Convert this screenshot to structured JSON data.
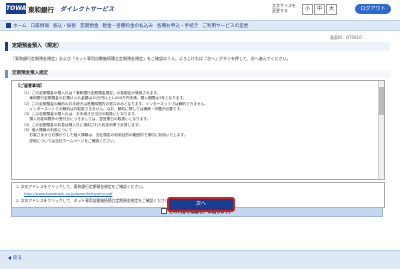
{
  "header": {
    "logo_mark": "TOWA",
    "bank_name": "東和銀行",
    "service_name": "ダイレクトサービス",
    "font_size_label": "文字サイズを\n変更する",
    "font_sizes": [
      "小",
      "中",
      "大"
    ],
    "logout_label": "ログアウト"
  },
  "nav": {
    "items": [
      "ホーム",
      "口座情報",
      "振込・振替",
      "定期預金",
      "税金・各種料金の払込み",
      "各種お申込・手続き",
      "ご利用サービスの変更"
    ]
  },
  "screen_id": "画面ID：BT0010",
  "page": {
    "title": "定期預金預入（規定）",
    "intro": "「東和銀行定期預金規定」および「ネット専用自動継続積立定期預金規定」をご確認のうえ、よろしければ「次へ」ボタンを押して、次へ進んでください。",
    "section_title": "定期預金預入規定"
  },
  "terms": {
    "heading": "【ご留意事項】",
    "lines": [
      "（1）この定期預金の預入れは「東和銀行定期預金規定」の各規定が適用されます。",
      "　　東和銀行定期預金のお預け入れ金額は10万円以上1,000万円未満、預入期間は3年となります。",
      "（2）この定期預金の解約のお手続きは営業時間内の窓口のみとなります。インターネットでは解約できません。",
      "　　インターネットでの解約はお取扱できません。なお、解約に際しては通帳・印鑑が必要です。",
      "（3）この定期預金の預入れは、お手続き日当日の取扱いとなります。",
      "　　預入可能時間外の受付分につきましては、翌営業日の取扱いとなります。",
      "（4）この定期預金の利息は預入日に適用された約定利率で計算します。",
      "（5）個人情報の利用について",
      "　　お客さまからお預かりした個人情報は、当社規定の利用目的の範囲内で適切に利用いたします。",
      "　　詳細については当社ホームページをご確認ください。"
    ]
  },
  "notes": {
    "line1": "1. 次のアドレスをクリックして、東和銀行定期預金規定をご確認ください。",
    "link1": "http://www.towabank.co.jp/open/teikiyokin.pdf",
    "line2": "2. 次のアドレスをクリックして、ネット専用自動継続積立定期預金規定をご確認ください。",
    "link2": "http://www.towabank.co.jp/open/tsumitate.pdf"
  },
  "confirm_label": "この内容を確認し、承諾します。",
  "next_label": "次へ",
  "back_label": "戻る"
}
